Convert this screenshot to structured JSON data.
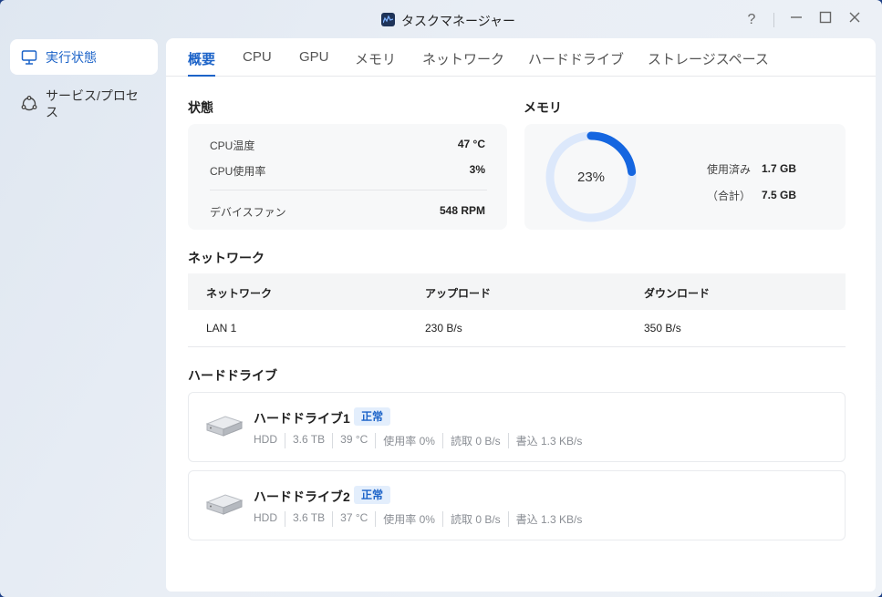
{
  "window": {
    "title": "タスクマネージャー",
    "help_label": "?"
  },
  "sidebar": {
    "items": [
      {
        "label": "実行状態",
        "icon": "monitor-icon",
        "active": true
      },
      {
        "label": "サービス/プロセス",
        "icon": "service-icon",
        "active": false
      }
    ]
  },
  "tabs": [
    "概要",
    "CPU",
    "GPU",
    "メモリ",
    "ネットワーク",
    "ハードドライブ",
    "ストレージスペース"
  ],
  "status": {
    "title": "状態",
    "rows": [
      {
        "label": "CPU温度",
        "value": "47 °C"
      },
      {
        "label": "CPU使用率",
        "value": "3%"
      },
      {
        "label": "デバイスファン",
        "value": "548 RPM"
      }
    ]
  },
  "memory": {
    "title": "メモリ",
    "percent_label": "23%",
    "percent": 0.23,
    "used_label": "使用済み",
    "used_value": "1.7 GB",
    "total_label": "（合計）",
    "total_value": "7.5 GB"
  },
  "network": {
    "title": "ネットワーク",
    "columns": [
      "ネットワーク",
      "アップロード",
      "ダウンロード"
    ],
    "rows": [
      {
        "name": "LAN 1",
        "upload": "230 B/s",
        "download": "350 B/s"
      }
    ]
  },
  "drives": {
    "title": "ハードドライブ",
    "items": [
      {
        "name": "ハードドライブ1",
        "status": "正常",
        "type": "HDD",
        "size": "3.6 TB",
        "temp": "39 °C",
        "usage": "使用率 0%",
        "read": "読取 0 B/s",
        "write": "書込 1.3 KB/s"
      },
      {
        "name": "ハードドライブ2",
        "status": "正常",
        "type": "HDD",
        "size": "3.6 TB",
        "temp": "37 °C",
        "usage": "使用率 0%",
        "read": "読取 0 B/s",
        "write": "書込 1.3 KB/s"
      }
    ]
  },
  "colors": {
    "accent": "#1c63c8",
    "ring_track": "#dce8fb",
    "ring_fill": "#1566e0"
  }
}
